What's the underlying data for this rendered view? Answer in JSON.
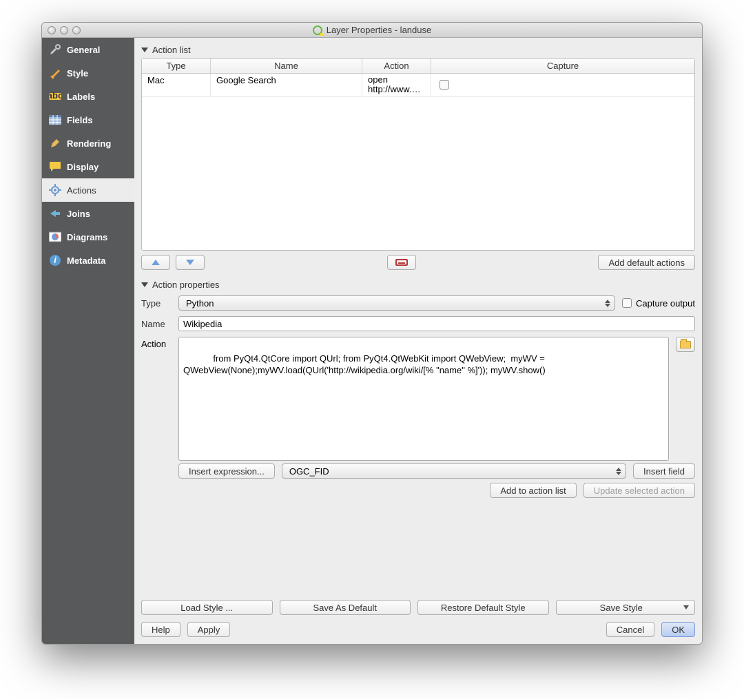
{
  "window": {
    "title": "Layer Properties - landuse"
  },
  "sidebar": {
    "items": [
      {
        "label": "General"
      },
      {
        "label": "Style"
      },
      {
        "label": "Labels"
      },
      {
        "label": "Fields"
      },
      {
        "label": "Rendering"
      },
      {
        "label": "Display"
      },
      {
        "label": "Actions"
      },
      {
        "label": "Joins"
      },
      {
        "label": "Diagrams"
      },
      {
        "label": "Metadata"
      }
    ]
  },
  "action_list": {
    "title": "Action list",
    "headers": {
      "type": "Type",
      "name": "Name",
      "action": "Action",
      "capture": "Capture"
    },
    "rows": [
      {
        "type": "Mac",
        "name": "Google Search",
        "action": "open http://www.g…",
        "capture": false
      }
    ],
    "add_defaults": "Add default actions"
  },
  "properties": {
    "title": "Action properties",
    "type_label": "Type",
    "type_value": "Python",
    "capture_output_label": "Capture output",
    "name_label": "Name",
    "name_value": "Wikipedia",
    "action_label": "Action",
    "action_value": "from PyQt4.QtCore import QUrl; from PyQt4.QtWebKit import QWebView;  myWV = QWebView(None);myWV.load(QUrl('http://wikipedia.org/wiki/[% \"name\" %]')); myWV.show()",
    "insert_expression": "Insert expression...",
    "field_value": "OGC_FID",
    "insert_field": "Insert field",
    "add_to_list": "Add to action list",
    "update_selected": "Update selected action"
  },
  "footer": {
    "load_style": "Load Style ...",
    "save_default": "Save As Default",
    "restore_default": "Restore Default Style",
    "save_style": "Save Style",
    "help": "Help",
    "apply": "Apply",
    "cancel": "Cancel",
    "ok": "OK"
  }
}
